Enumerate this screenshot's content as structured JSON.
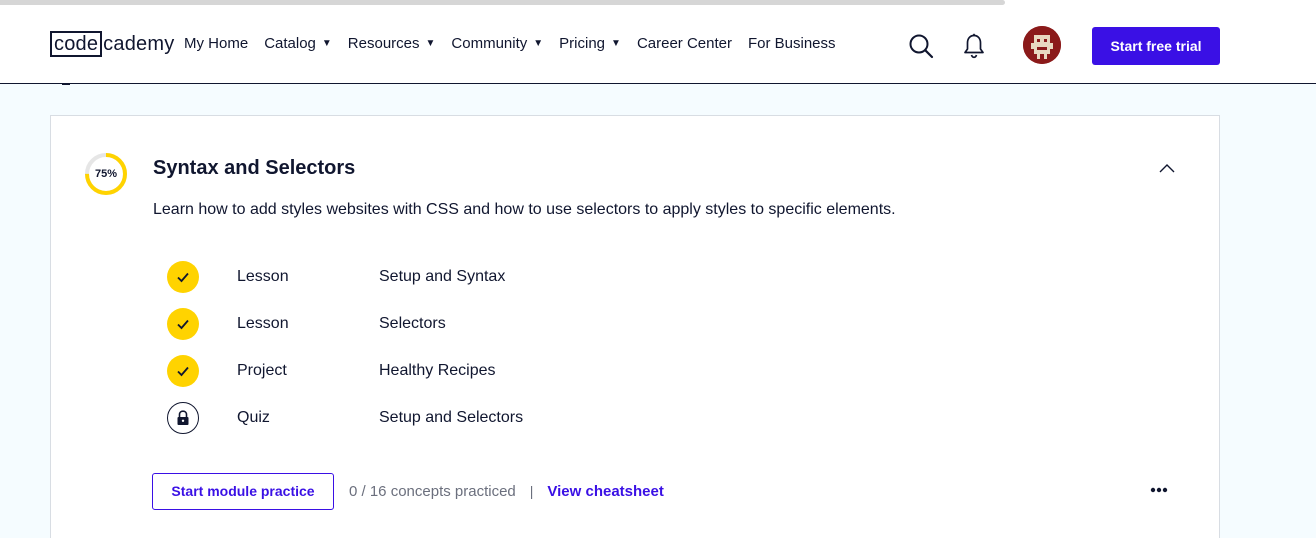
{
  "header": {
    "logo": {
      "boxed": "code",
      "rest": "cademy"
    },
    "nav": [
      {
        "label": "My Home",
        "dropdown": false
      },
      {
        "label": "Catalog",
        "dropdown": true
      },
      {
        "label": "Resources",
        "dropdown": true
      },
      {
        "label": "Community",
        "dropdown": true
      },
      {
        "label": "Pricing",
        "dropdown": true
      },
      {
        "label": "Career Center",
        "dropdown": false
      },
      {
        "label": "For Business",
        "dropdown": false
      }
    ],
    "icons": {
      "search": "search-icon",
      "notifications": "bell-icon",
      "dropdown": "caret-down-icon"
    },
    "cta_label": "Start free trial",
    "accent": "#3a10e5"
  },
  "module": {
    "progress_label": "75%",
    "progress_fraction": 0.75,
    "progress_color": "#ffd300",
    "title": "Syntax and Selectors",
    "description": "Learn how to add styles websites with CSS and how to use selectors to apply styles to specific elements.",
    "items": [
      {
        "type": "Lesson",
        "name": "Setup and Syntax",
        "status": "complete",
        "icon": "check-icon"
      },
      {
        "type": "Lesson",
        "name": "Selectors",
        "status": "complete",
        "icon": "check-icon"
      },
      {
        "type": "Project",
        "name": "Healthy Recipes",
        "status": "complete",
        "icon": "check-icon"
      },
      {
        "type": "Quiz",
        "name": "Setup and Selectors",
        "status": "locked",
        "icon": "lock-icon"
      }
    ],
    "practice_label": "Start module practice",
    "concepts_text": "0 / 16 concepts practiced",
    "separator": "|",
    "cheatsheet_label": "View cheatsheet",
    "more_icon": "more-horizontal-icon",
    "collapse_icon": "chevron-up-icon"
  }
}
